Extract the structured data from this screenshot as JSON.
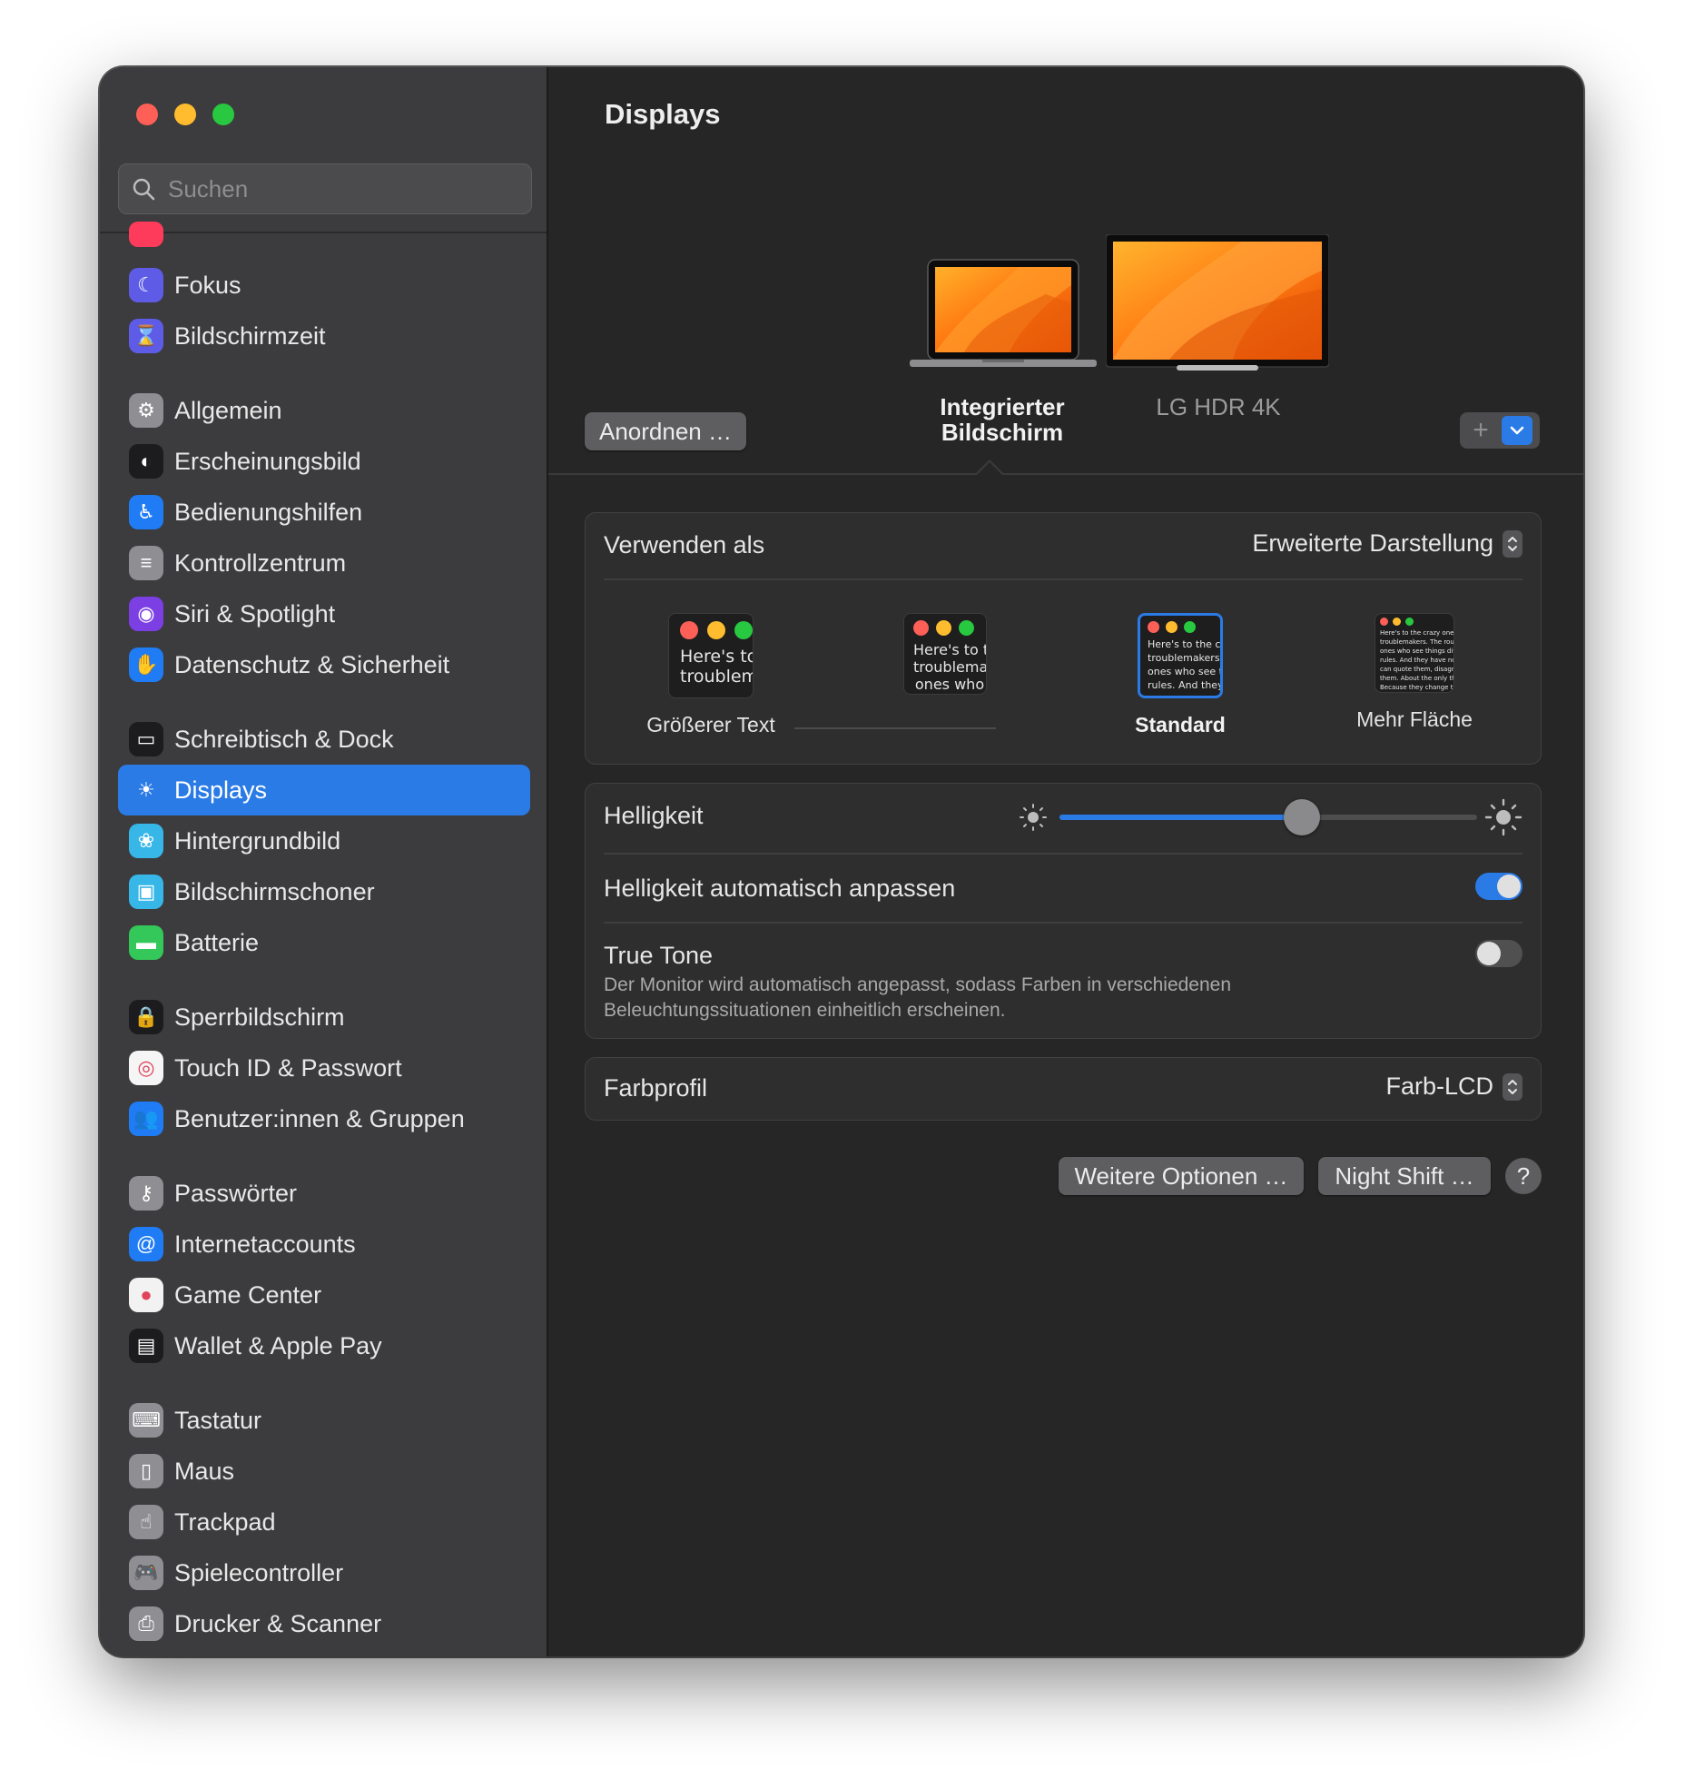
{
  "window": {
    "traffic_colors": [
      "#fe5f57",
      "#febc2e",
      "#28c840"
    ]
  },
  "sidebar": {
    "search_placeholder": "Suchen",
    "groups": [
      [
        {
          "label": "Fokus",
          "icon": "moon-icon",
          "color": "#5e5ce6"
        },
        {
          "label": "Bildschirmzeit",
          "icon": "hourglass-icon",
          "color": "#5e5ce6"
        }
      ],
      [
        {
          "label": "Allgemein",
          "icon": "gear-icon",
          "color": "#8e8e93"
        },
        {
          "label": "Erscheinungsbild",
          "icon": "appearance-icon",
          "color": "#1c1c1e"
        },
        {
          "label": "Bedienungshilfen",
          "icon": "accessibility-icon",
          "color": "#1f7cf4"
        },
        {
          "label": "Kontrollzentrum",
          "icon": "control-center-icon",
          "color": "#8e8e93"
        },
        {
          "label": "Siri & Spotlight",
          "icon": "siri-icon",
          "color": "#7b3fe4"
        },
        {
          "label": "Datenschutz & Sicherheit",
          "icon": "hand-icon",
          "color": "#1f7cf4"
        }
      ],
      [
        {
          "label": "Schreibtisch & Dock",
          "icon": "dock-icon",
          "color": "#1c1c1e"
        },
        {
          "label": "Displays",
          "icon": "sun-icon",
          "color": "#1f7cf4",
          "selected": true
        },
        {
          "label": "Hintergrundbild",
          "icon": "wallpaper-icon",
          "color": "#37b6e8"
        },
        {
          "label": "Bildschirmschoner",
          "icon": "screensaver-icon",
          "color": "#37b6e8"
        },
        {
          "label": "Batterie",
          "icon": "battery-icon",
          "color": "#34c759"
        }
      ],
      [
        {
          "label": "Sperrbildschirm",
          "icon": "lock-icon",
          "color": "#1c1c1e"
        },
        {
          "label": "Touch ID & Passwort",
          "icon": "fingerprint-icon",
          "color": "#f5f5f5"
        },
        {
          "label": "Benutzer:innen & Gruppen",
          "icon": "users-icon",
          "color": "#1f7cf4"
        }
      ],
      [
        {
          "label": "Passwörter",
          "icon": "key-icon",
          "color": "#8e8e93"
        },
        {
          "label": "Internetaccounts",
          "icon": "at-icon",
          "color": "#1f7cf4"
        },
        {
          "label": "Game Center",
          "icon": "game-center-icon",
          "color": "#f2f2f2"
        },
        {
          "label": "Wallet & Apple Pay",
          "icon": "wallet-icon",
          "color": "#1c1c1e"
        }
      ],
      [
        {
          "label": "Tastatur",
          "icon": "keyboard-icon",
          "color": "#8e8e93"
        },
        {
          "label": "Maus",
          "icon": "mouse-icon",
          "color": "#8e8e93"
        },
        {
          "label": "Trackpad",
          "icon": "trackpad-icon",
          "color": "#8e8e93"
        },
        {
          "label": "Spielecontroller",
          "icon": "gamecontroller-icon",
          "color": "#8e8e93"
        },
        {
          "label": "Drucker & Scanner",
          "icon": "printer-icon",
          "color": "#8e8e93"
        }
      ]
    ]
  },
  "main": {
    "title": "Displays",
    "arrange_button": "Anordnen …",
    "displays": [
      {
        "name": "Integrierter Bildschirm",
        "name_lines": [
          "Integrierter",
          "Bildschirm"
        ],
        "selected": true,
        "icon": "laptop-icon"
      },
      {
        "name": "LG HDR 4K",
        "selected": false,
        "icon": "monitor-icon"
      }
    ],
    "use_as": {
      "label": "Verwenden als",
      "value": "Erweiterte Darstellung"
    },
    "resolution": {
      "options": [
        {
          "caption": "Größerer Text",
          "preview": "Here's to\ntroublem"
        },
        {
          "caption": "",
          "preview": "Here's to t\ntroublema\nones who"
        },
        {
          "caption": "Standard",
          "preview": "Here's to the cr\ntroublemakers.\nones who see t\nrules. And they",
          "selected": true
        },
        {
          "caption": "Mehr Fläche",
          "preview": "Here's to the crazy one\ntroublemakers. The rou\nones who see things dif\nrules. And they have no\ncan quote them, disagr\nthem. About the only th\nBecause they change th"
        }
      ]
    },
    "brightness": {
      "label": "Helligkeit",
      "value": 0.58,
      "auto_label": "Helligkeit automatisch anpassen",
      "auto_on": true
    },
    "true_tone": {
      "label": "True Tone",
      "description": "Der Monitor wird automatisch angepasst, sodass Farben in verschiedenen Beleuchtungssituationen einheitlich erscheinen.",
      "on": false
    },
    "color_profile": {
      "label": "Farbprofil",
      "value": "Farb-LCD"
    },
    "buttons": {
      "more_options": "Weitere Optionen …",
      "night_shift": "Night Shift …",
      "help": "?"
    },
    "accent": "#2a7be6"
  }
}
